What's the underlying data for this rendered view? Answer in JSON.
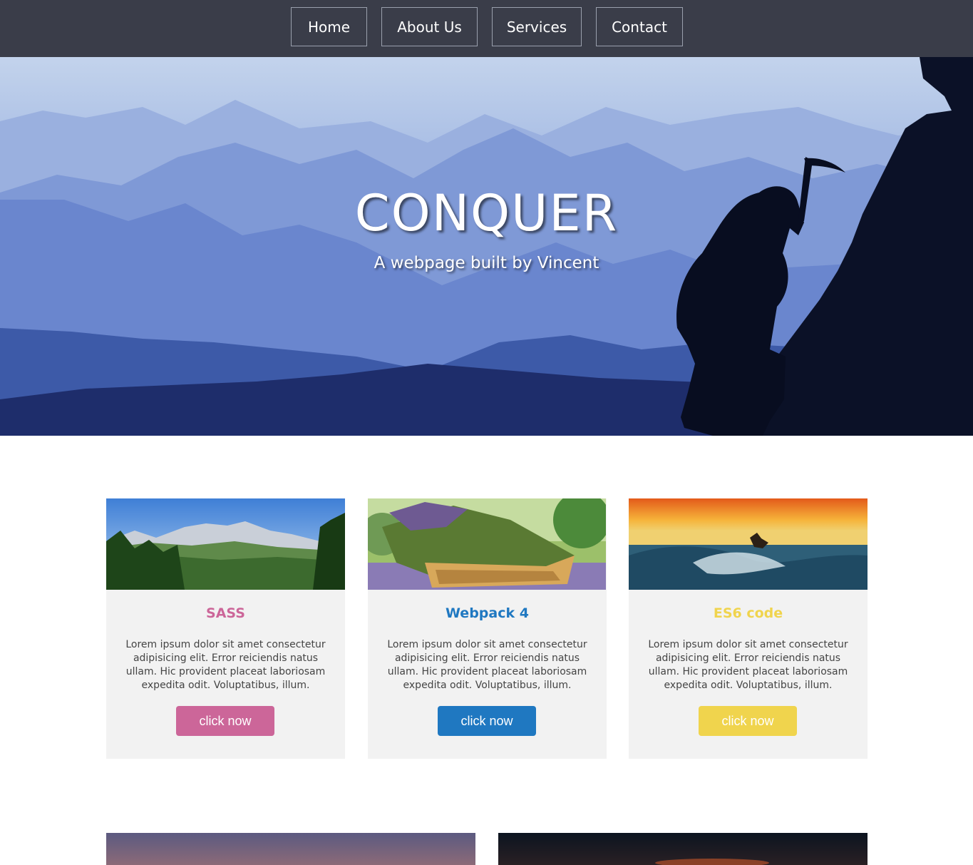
{
  "nav": {
    "items": [
      {
        "label": "Home"
      },
      {
        "label": "About Us"
      },
      {
        "label": "Services"
      },
      {
        "label": "Contact"
      }
    ]
  },
  "hero": {
    "title": "CONQUER",
    "subtitle": "A webpage built by Vincent"
  },
  "cards": [
    {
      "title": "SASS",
      "text": "Lorem ipsum dolor sit amet consectetur adipisicing elit. Error reiciendis natus ullam. Hic provident placeat laboriosam expedita odit. Voluptatibus, illum.",
      "button": "click now",
      "accent": "#cc6699"
    },
    {
      "title": "Webpack 4",
      "text": "Lorem ipsum dolor sit amet consectetur adipisicing elit. Error reiciendis natus ullam. Hic provident placeat laboriosam expedita odit. Voluptatibus, illum.",
      "button": "click now",
      "accent": "#1f78c1"
    },
    {
      "title": "ES6 code",
      "text": "Lorem ipsum dolor sit amet consectetur adipisicing elit. Error reiciendis natus ullam. Hic provident placeat laboriosam expedita odit. Voluptatibus, illum.",
      "button": "click now",
      "accent": "#f0d44d"
    }
  ],
  "colors": {
    "nav_bg": "#3a3d49",
    "card_bg": "#f2f2f2"
  }
}
